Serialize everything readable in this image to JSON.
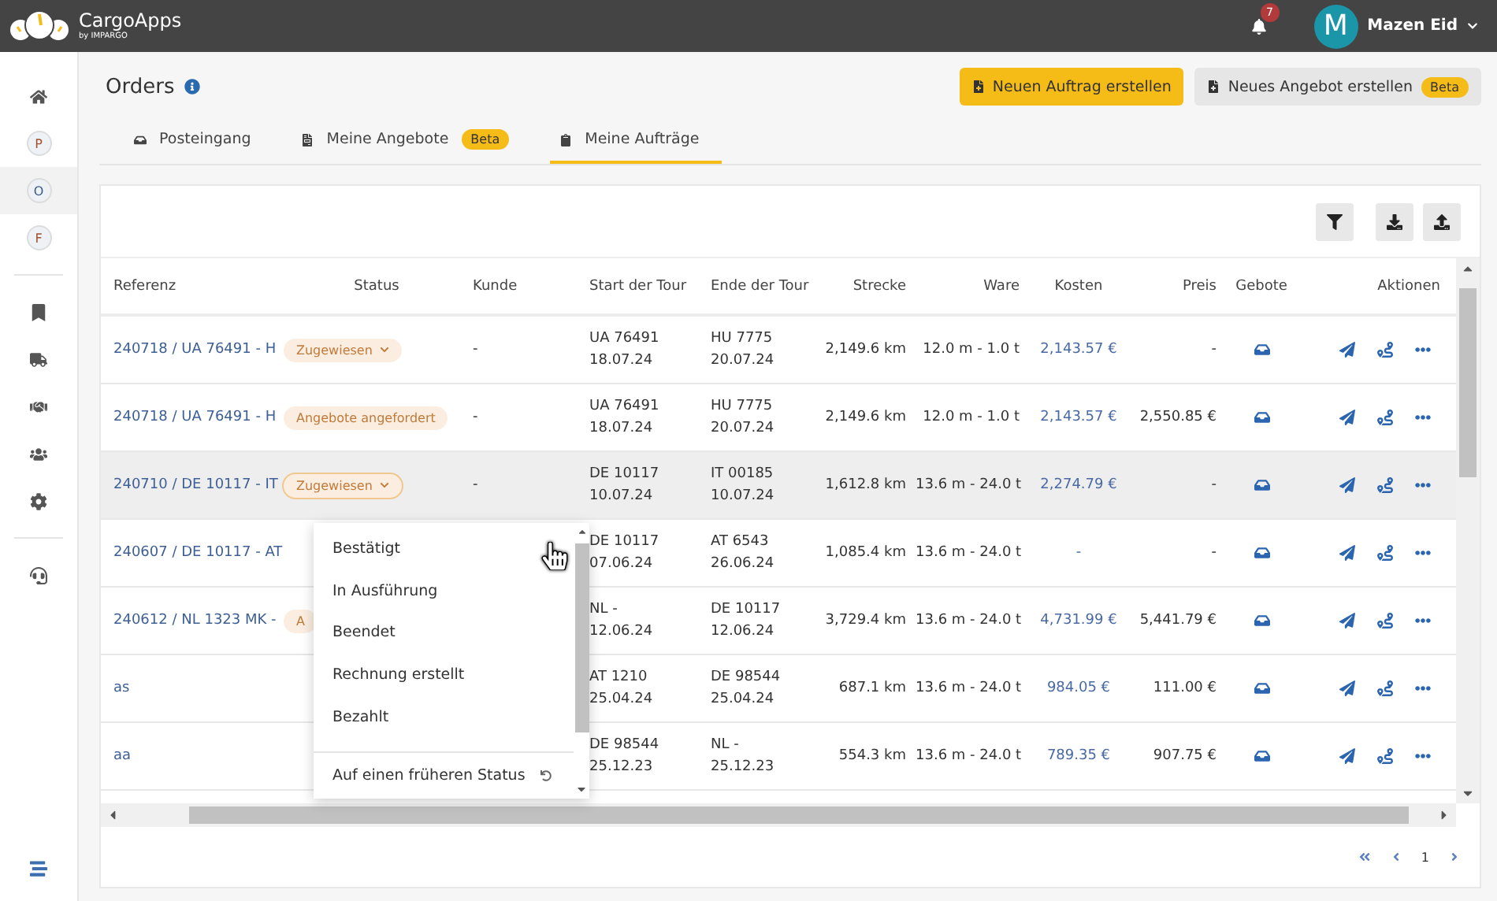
{
  "topbar": {
    "logo_title": "CargoApps",
    "logo_subtitle": "by IMPARGO",
    "notifications": "7",
    "user": {
      "initial": "M",
      "name": "Mazen Eid"
    }
  },
  "sidebar": {
    "items": [
      {
        "kind": "icon",
        "selected": false
      },
      {
        "kind": "letter",
        "label": "P",
        "selected": false
      },
      {
        "kind": "letter",
        "label": "O",
        "selected": true
      },
      {
        "kind": "letter",
        "label": "F",
        "selected": false
      },
      {
        "kind": "divider"
      },
      {
        "kind": "icon",
        "selected": false
      },
      {
        "kind": "icon",
        "selected": false
      },
      {
        "kind": "icon",
        "selected": false
      },
      {
        "kind": "icon",
        "selected": false
      },
      {
        "kind": "icon",
        "selected": false
      },
      {
        "kind": "divider"
      },
      {
        "kind": "icon",
        "selected": false
      }
    ]
  },
  "page": {
    "title": "Orders",
    "actions": [
      {
        "label": "Neuen Auftrag erstellen",
        "kind": "primary"
      },
      {
        "label": "Neues Angebot erstellen",
        "kind": "secondary",
        "badge": "Beta"
      }
    ]
  },
  "tabs": [
    {
      "label": "Posteingang",
      "selected": false
    },
    {
      "label": "Meine Angebote",
      "badge": "Beta",
      "selected": false
    },
    {
      "label": "Meine Aufträge",
      "selected": true
    }
  ],
  "table": {
    "columns": [
      "Referenz",
      "Status",
      "Kunde",
      "Start der Tour",
      "Ende der Tour",
      "Strecke",
      "Ware",
      "Kosten",
      "Preis",
      "Gebote",
      "Aktionen"
    ],
    "rows": [
      {
        "reference": "240718 / UA 76491 - H",
        "status": {
          "label": "Zugewiesen",
          "dropdown": true,
          "expanded": false
        },
        "customer": "-",
        "start": [
          "UA 76491",
          "18.07.24"
        ],
        "end": [
          "HU 7775",
          "20.07.24"
        ],
        "distance": "2,149.6 km",
        "goods": "12.0 m - 1.0 t",
        "cost": "2,143.57 €",
        "price": "-",
        "highlighted": false
      },
      {
        "reference": "240718 / UA 76491 - H",
        "status": {
          "label": "Angebote angefordert",
          "dropdown": false,
          "expanded": false
        },
        "customer": "-",
        "start": [
          "UA 76491",
          "18.07.24"
        ],
        "end": [
          "HU 7775",
          "20.07.24"
        ],
        "distance": "2,149.6 km",
        "goods": "12.0 m - 1.0 t",
        "cost": "2,143.57 €",
        "price": "2,550.85 €",
        "highlighted": false
      },
      {
        "reference": "240710 / DE 10117 - IT",
        "status": {
          "label": "Zugewiesen",
          "dropdown": true,
          "expanded": true
        },
        "customer": "-",
        "start": [
          "DE 10117",
          "10.07.24"
        ],
        "end": [
          "IT 00185",
          "10.07.24"
        ],
        "distance": "1,612.8 km",
        "goods": "13.6 m - 24.0 t",
        "cost": "2,274.79 €",
        "price": "-",
        "highlighted": true
      },
      {
        "reference": "240607 / DE 10117 - AT",
        "start": [
          "DE 10117",
          "07.06.24"
        ],
        "end": [
          "AT 6543",
          "26.06.24"
        ],
        "distance": "1,085.4 km",
        "goods": "13.6 m - 24.0 t",
        "cost": "-",
        "price": "-",
        "highlighted": false
      },
      {
        "reference": "240612 / NL 1323 MK -",
        "status": {
          "label": "A",
          "dropdown": false,
          "expanded": false
        },
        "start": [
          "NL -",
          "12.06.24"
        ],
        "end": [
          "DE 10117",
          "12.06.24"
        ],
        "distance": "3,729.4 km",
        "goods": "13.6 m - 24.0 t",
        "cost": "4,731.99 €",
        "price": "5,441.79 €",
        "highlighted": false
      },
      {
        "reference": "as",
        "start": [
          "AT 1210",
          "25.04.24"
        ],
        "end": [
          "DE 98544",
          "25.04.24"
        ],
        "distance": "687.1 km",
        "goods": "13.6 m - 24.0 t",
        "cost": "984.05 €",
        "price": "111.00 €",
        "highlighted": false
      },
      {
        "reference": "aa",
        "start": [
          "DE 98544",
          "25.12.23"
        ],
        "end": [
          "NL -",
          "25.12.23"
        ],
        "distance": "554.3 km",
        "goods": "13.6 m - 24.0 t",
        "cost": "789.35 €",
        "price": "907.75 €",
        "highlighted": false
      }
    ]
  },
  "status_menu": {
    "items": [
      "Bestätigt",
      "In Ausführung",
      "Beendet",
      "Rechnung erstellt",
      "Bezahlt"
    ],
    "footer": "Auf einen früheren Status"
  },
  "pagination": {
    "page": "1"
  }
}
